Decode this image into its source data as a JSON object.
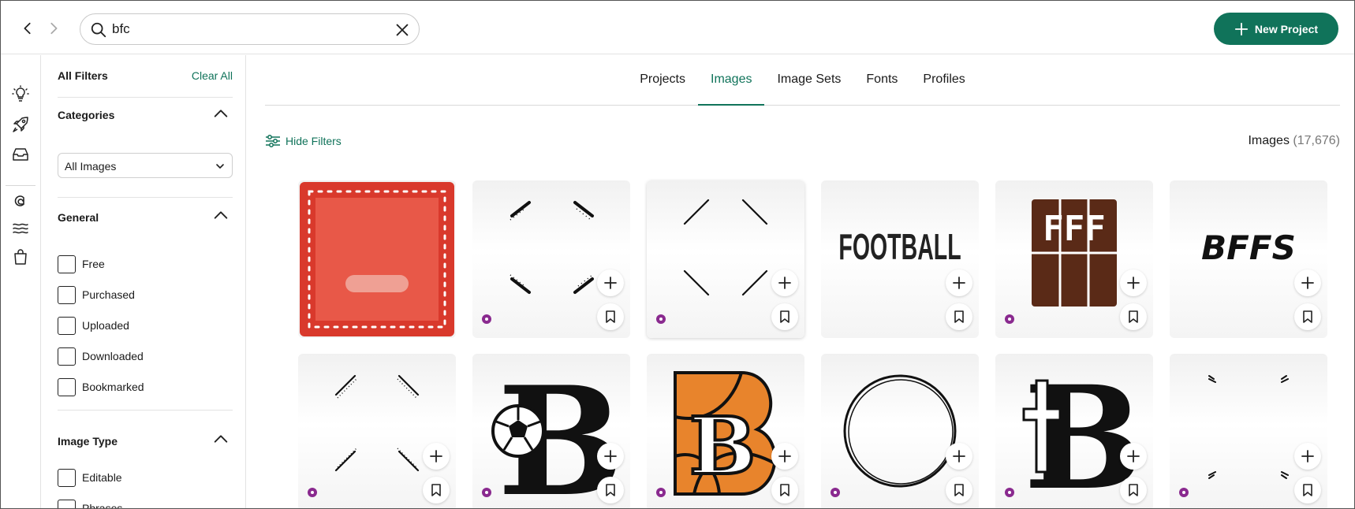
{
  "search": {
    "value": "bfc"
  },
  "header": {
    "new_project_label": "New Project"
  },
  "filters": {
    "title": "All Filters",
    "clear_label": "Clear All",
    "categories": {
      "title": "Categories",
      "selected": "All Images"
    },
    "general": {
      "title": "General",
      "options": [
        "Free",
        "Purchased",
        "Uploaded",
        "Downloaded",
        "Bookmarked"
      ]
    },
    "image_type": {
      "title": "Image Type",
      "options": [
        "Editable",
        "Phrases"
      ]
    }
  },
  "tabs": [
    "Projects",
    "Images",
    "Image Sets",
    "Fonts",
    "Profiles"
  ],
  "active_tab": "Images",
  "hide_filters_label": "Hide Filters",
  "results": {
    "label": "Images",
    "count": "(17,676)"
  },
  "cards": [
    {
      "name": "red-stamp-frame",
      "art_text": ""
    },
    {
      "name": "dotted-corner-frame",
      "art_text": ""
    },
    {
      "name": "line-corner-frame",
      "art_text": ""
    },
    {
      "name": "football-word",
      "art_text": "FOOTBALL"
    },
    {
      "name": "fff-chocolate-bar",
      "art_text": "FFF"
    },
    {
      "name": "bffs-word",
      "art_text": "BFFS"
    },
    {
      "name": "dotted-corner-frame-2",
      "art_text": ""
    },
    {
      "name": "soccer-ball-b-monogram",
      "art_text": "B"
    },
    {
      "name": "basketball-b-monogram",
      "art_text": "B"
    },
    {
      "name": "circle-frame",
      "art_text": ""
    },
    {
      "name": "cross-b-monogram",
      "art_text": "B"
    },
    {
      "name": "dash-corner-frame",
      "art_text": ""
    }
  ],
  "colors": {
    "accent": "#10735a",
    "badge": "#8a2a8f",
    "stamp_red": "#d9392c",
    "chocolate": "#5a2a17",
    "basketball": "#e8842c"
  },
  "icons": [
    "back-arrow-icon",
    "forward-arrow-icon",
    "search-icon",
    "clear-icon",
    "plus-icon",
    "lightbulb-icon",
    "rocket-icon",
    "inbox-icon",
    "cricut-icon",
    "waves-icon",
    "shopping-bag-icon",
    "chevron-up-icon",
    "chevron-down-icon",
    "sliders-icon",
    "bookmark-icon",
    "premium-badge-icon"
  ]
}
